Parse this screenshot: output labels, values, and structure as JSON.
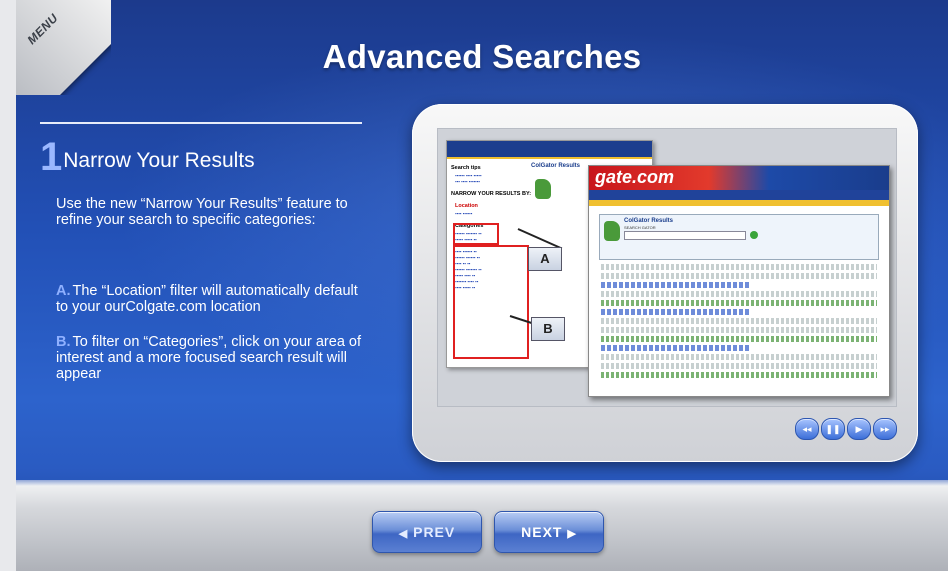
{
  "menu": {
    "label": "MENU"
  },
  "title": "Advanced Searches",
  "step": {
    "number": "1",
    "title": "Narrow Your Results"
  },
  "intro": "Use the new “Narrow Your Results” feature to refine your search to specific categories:",
  "items": [
    {
      "letter": "A.",
      "text": "The “Location” filter will automatically default to your ourColgate.com location"
    },
    {
      "letter": "B.",
      "text": "To filter on “Categories”, click on your area of interest and a more focused search result will appear"
    }
  ],
  "screenshot": {
    "callouts": [
      "A",
      "B"
    ],
    "brand": "gate.com",
    "results_heading": "ColGator Results",
    "search_label": "SEARCH GATOR",
    "narrow_heading": "NARROW YOUR RESULTS BY:",
    "location_label": "Location",
    "categories_label": "Categories",
    "search_tips": "Search tips"
  },
  "player_controls": [
    {
      "name": "rewind",
      "glyph": "◂◂"
    },
    {
      "name": "pause",
      "glyph": "❚❚"
    },
    {
      "name": "play",
      "glyph": "▶"
    },
    {
      "name": "end",
      "glyph": "▸▸"
    }
  ],
  "nav": {
    "prev": "PREV",
    "next": "NEXT",
    "prev_arrow": "◀",
    "next_arrow": "▶"
  }
}
